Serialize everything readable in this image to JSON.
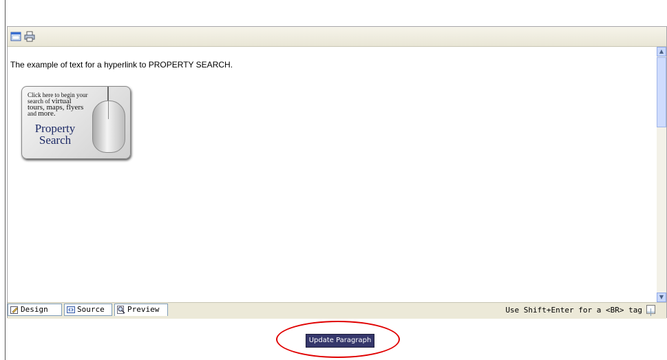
{
  "editor": {
    "toolbar": {
      "icons": [
        "window-icon",
        "print-icon"
      ]
    },
    "content": {
      "text": "The example of text for a hyperlink to PROPERTY SEARCH.",
      "banner": {
        "line1": "Click here to begin your",
        "line2": "search of",
        "line2b": "virtual",
        "line3": "tours, maps, flyers",
        "line4": "and",
        "line4b": "more.",
        "title1": "Property",
        "title2": "Search"
      }
    },
    "tabs": [
      {
        "label": "Design"
      },
      {
        "label": "Source"
      },
      {
        "label": "Preview",
        "active": true
      }
    ],
    "hint": "Use Shift+Enter for a <BR> tag"
  },
  "update_button": {
    "label": "Update Paragraph"
  },
  "colors": {
    "highlight_oval": "#e00000",
    "button_bg": "#35376b"
  }
}
